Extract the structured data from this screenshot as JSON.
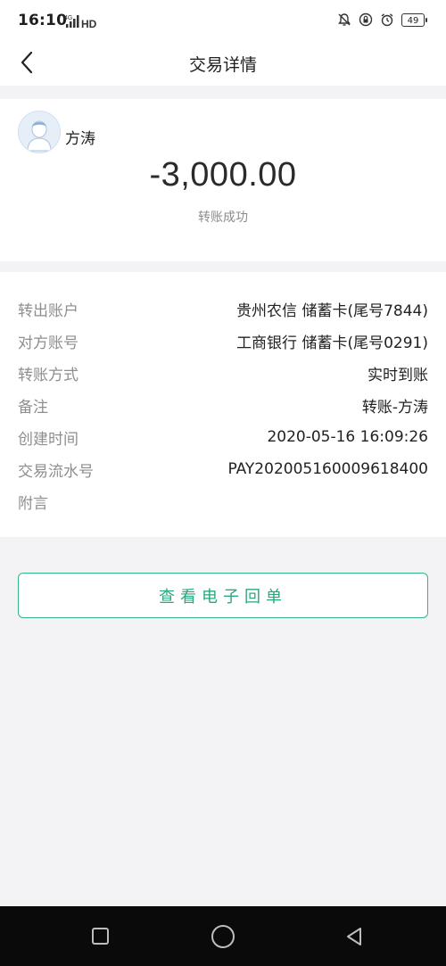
{
  "status_bar": {
    "time": "16:10",
    "network": "4G",
    "hd": "HD",
    "battery": "49"
  },
  "header": {
    "title": "交易详情"
  },
  "summary": {
    "payee_name": "方涛",
    "amount": "-3,000.00",
    "status": "转账成功"
  },
  "details": [
    {
      "label": "转出账户",
      "value": "贵州农信 储蓄卡(尾号7844)"
    },
    {
      "label": "对方账号",
      "value": "工商银行 储蓄卡(尾号0291)"
    },
    {
      "label": "转账方式",
      "value": "实时到账"
    },
    {
      "label": "备注",
      "value": "转账-方涛"
    },
    {
      "label": "创建时间",
      "value": "2020-05-16 16:09:26"
    },
    {
      "label": "交易流水号",
      "value": "PAY202005160009618400"
    },
    {
      "label": "附言",
      "value": ""
    }
  ],
  "actions": {
    "view_receipt": "查看电子回单"
  },
  "colors": {
    "accent": "#2aa77e",
    "background": "#f3f3f5",
    "label_gray": "#8e8e8e"
  },
  "icons": [
    "back-arrow-icon",
    "signal-icon",
    "bell-muted-icon",
    "lock-icon",
    "alarm-icon",
    "battery-icon",
    "avatar-icon",
    "nav-recent-icon",
    "nav-home-icon",
    "nav-back-icon"
  ]
}
